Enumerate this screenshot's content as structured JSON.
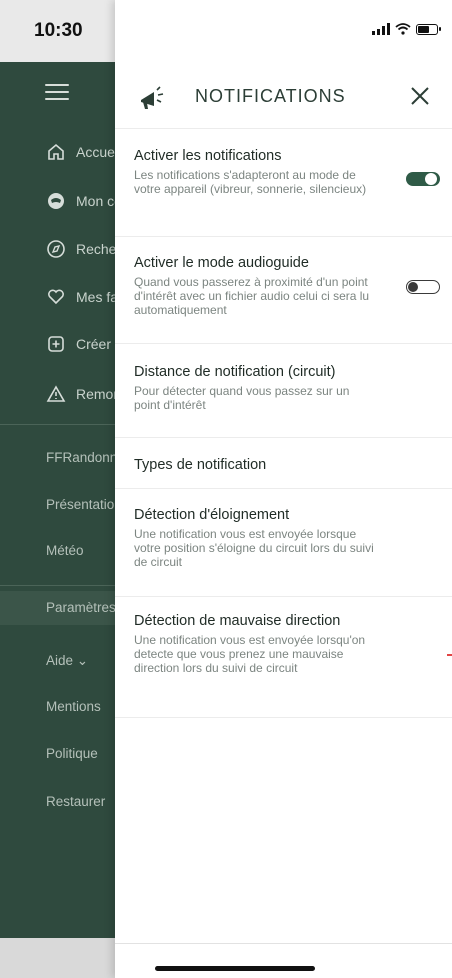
{
  "status_bar": {
    "time": "10:30"
  },
  "drawer": {
    "menu_items": [
      {
        "label": "Accueil",
        "icon": "home-icon"
      },
      {
        "label": "Mon compte",
        "icon": "account-icon"
      },
      {
        "label": "Recherche",
        "icon": "compass-icon"
      },
      {
        "label": "Mes favoris",
        "icon": "heart-icon"
      },
      {
        "label": "Créer",
        "icon": "plus-square-icon"
      },
      {
        "label": "Remonter",
        "icon": "warning-icon"
      }
    ],
    "sections": [
      {
        "label": "FFRandonnée"
      },
      {
        "label": "Présentation"
      },
      {
        "label": "Météo"
      },
      {
        "label": "Paramètres"
      },
      {
        "label": "Aide ⌄"
      },
      {
        "label": "Mentions"
      },
      {
        "label": "Politique"
      },
      {
        "label": "Restaurer"
      }
    ]
  },
  "panel": {
    "title": "NOTIFICATIONS",
    "header_icon": "megaphone-icon",
    "close_icon": "close-icon",
    "settings": [
      {
        "title": "Activer les notifications",
        "desc": "Les notifications s'adapteront au mode de votre appareil (vibreur, sonnerie, silencieux)",
        "toggle": "on"
      },
      {
        "title": "Activer le mode audioguide",
        "desc": "Quand vous passerez à proximité d'un point d'intérêt avec un fichier audio celui ci sera lu automatiquement",
        "toggle": "off"
      },
      {
        "title": "Distance de notification (circuit)",
        "desc": "Pour détecter quand vous passez sur un point d'intérêt"
      },
      {
        "title": "Types de notification",
        "desc": ""
      },
      {
        "title": "Détection d'éloignement",
        "desc": "Une notification vous est envoyée lorsque votre position s'éloigne du circuit lors du suivi de circuit"
      },
      {
        "title": "Détection de mauvaise direction",
        "desc": "Une notification vous est envoyée lorsqu'on detecte que vous prenez une mauvaise direction lors du suivi de circuit"
      }
    ]
  },
  "colors": {
    "drawer_bg": "#2f4a3e",
    "accent_green": "#2f5b47",
    "title_text": "#1f2b25",
    "desc_text": "#7c8581"
  }
}
